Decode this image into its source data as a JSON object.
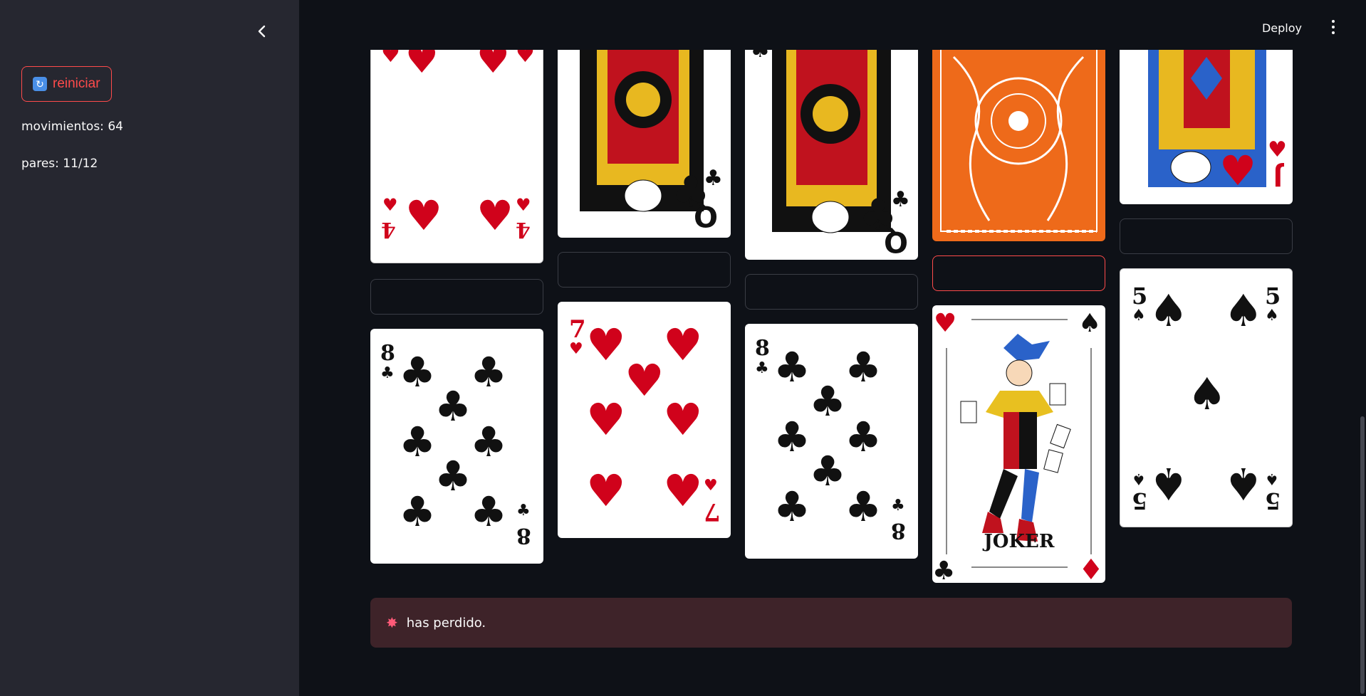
{
  "sidebar": {
    "restart_label": "reiniciar",
    "moves_text": "movimientos: 64",
    "pairs_text": "pares: 11/12"
  },
  "header": {
    "deploy_label": "Deploy"
  },
  "cards": [
    {
      "rank": "4",
      "suit": "♥",
      "face": "up"
    },
    {
      "rank": "Q",
      "suit": "♣",
      "face": "up"
    },
    {
      "rank": "Q",
      "suit": "♣",
      "face": "up"
    },
    {
      "rank": "",
      "suit": "",
      "face": "down"
    },
    {
      "rank": "J",
      "suit": "♥",
      "face": "up"
    },
    {
      "rank": "8",
      "suit": "♣",
      "face": "up"
    },
    {
      "rank": "7",
      "suit": "♥",
      "face": "up"
    },
    {
      "rank": "8",
      "suit": "♣",
      "face": "up"
    },
    {
      "rank": "JOKER",
      "suit": "",
      "face": "up"
    },
    {
      "rank": "5",
      "suit": "♠",
      "face": "up"
    }
  ],
  "alert": {
    "icon": "explosion-icon",
    "text": "has perdido."
  }
}
